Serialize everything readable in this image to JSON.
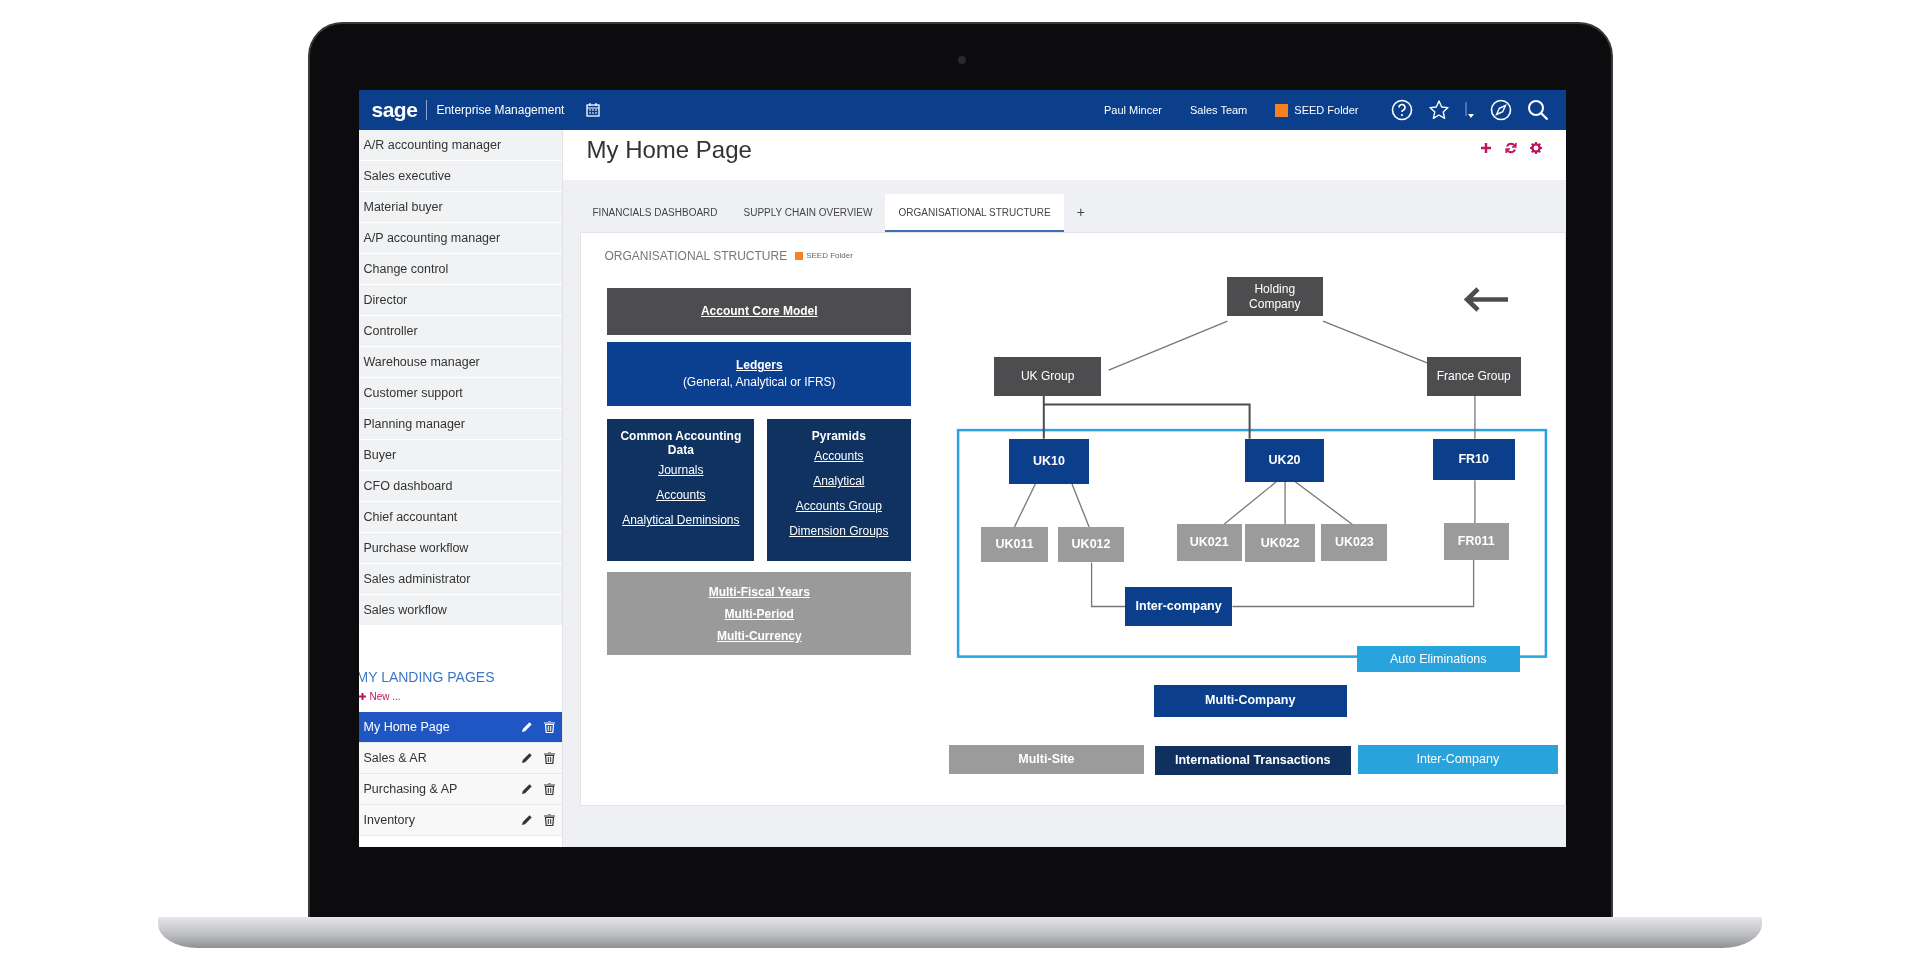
{
  "top_bar": {
    "brand": "sage",
    "product": "Enterprise Management",
    "user": "Paul Mincer",
    "team": "Sales Team",
    "folder": "SEED Folder"
  },
  "sidebar": {
    "items": [
      {
        "label": "A/R accounting manager"
      },
      {
        "label": "Sales executive"
      },
      {
        "label": "Material buyer"
      },
      {
        "label": "A/P accounting manager"
      },
      {
        "label": "Change control"
      },
      {
        "label": "Director"
      },
      {
        "label": "Controller"
      },
      {
        "label": "Warehouse manager"
      },
      {
        "label": "Customer support"
      },
      {
        "label": "Planning manager"
      },
      {
        "label": "Buyer"
      },
      {
        "label": "CFO dashboard"
      },
      {
        "label": "Chief accountant"
      },
      {
        "label": "Purchase workflow"
      },
      {
        "label": "Sales administrator"
      },
      {
        "label": "Sales workflow"
      }
    ],
    "landing_heading": "MY LANDING PAGES",
    "new_link": "New ...",
    "landing_pages": [
      {
        "label": "My Home Page",
        "selected": true
      },
      {
        "label": "Sales & AR",
        "selected": false
      },
      {
        "label": "Purchasing & AP",
        "selected": false
      },
      {
        "label": "Inventory",
        "selected": false
      }
    ]
  },
  "page": {
    "title": "My Home Page"
  },
  "tabs": [
    {
      "label": "FINANCIALS DASHBOARD",
      "selected": false
    },
    {
      "label": "SUPPLY CHAIN OVERVIEW",
      "selected": false
    },
    {
      "label": "ORGANISATIONAL STRUCTURE",
      "selected": true
    }
  ],
  "add_tab": "+",
  "panel": {
    "title": "ORGANISATIONAL STRUCTURE",
    "folder": "SEED Folder"
  },
  "diagram": {
    "left_blocks": [
      {
        "kind": "header",
        "title": "Account Core Model"
      },
      {
        "kind": "ledger",
        "title": "Ledgers",
        "subtitle": "(General, Analytical or IFRS)"
      },
      {
        "kind": "column",
        "title": "Common Accounting Data",
        "links": [
          "Journals",
          "Accounts",
          "Analytical Deminsions"
        ]
      },
      {
        "kind": "column",
        "title": "Pyramids",
        "links": [
          "Accounts",
          "Analytical",
          "Accounts Group",
          "Dimension Groups"
        ]
      },
      {
        "kind": "options",
        "links": [
          "Multi-Fiscal Years",
          "Multi-Period",
          "Multi-Currency"
        ]
      }
    ],
    "org_nodes": [
      {
        "label": "Holding Company",
        "kind": "group"
      },
      {
        "label": "UK Group",
        "kind": "group"
      },
      {
        "label": "France Group",
        "kind": "group"
      },
      {
        "label": "UK10",
        "kind": "company"
      },
      {
        "label": "UK20",
        "kind": "company"
      },
      {
        "label": "FR10",
        "kind": "company"
      },
      {
        "label": "UK011",
        "kind": "site"
      },
      {
        "label": "UK012",
        "kind": "site"
      },
      {
        "label": "UK021",
        "kind": "site"
      },
      {
        "label": "UK022",
        "kind": "site"
      },
      {
        "label": "UK023",
        "kind": "site"
      },
      {
        "label": "FR011",
        "kind": "site"
      },
      {
        "label": "Inter-company",
        "kind": "company"
      },
      {
        "label": "Auto Eliminations",
        "kind": "accent"
      },
      {
        "label": "Multi-Company",
        "kind": "company"
      },
      {
        "label": "Multi-Site",
        "kind": "site"
      },
      {
        "label": "International Transactions",
        "kind": "dark"
      },
      {
        "label": "Inter-Company",
        "kind": "accent"
      }
    ]
  }
}
